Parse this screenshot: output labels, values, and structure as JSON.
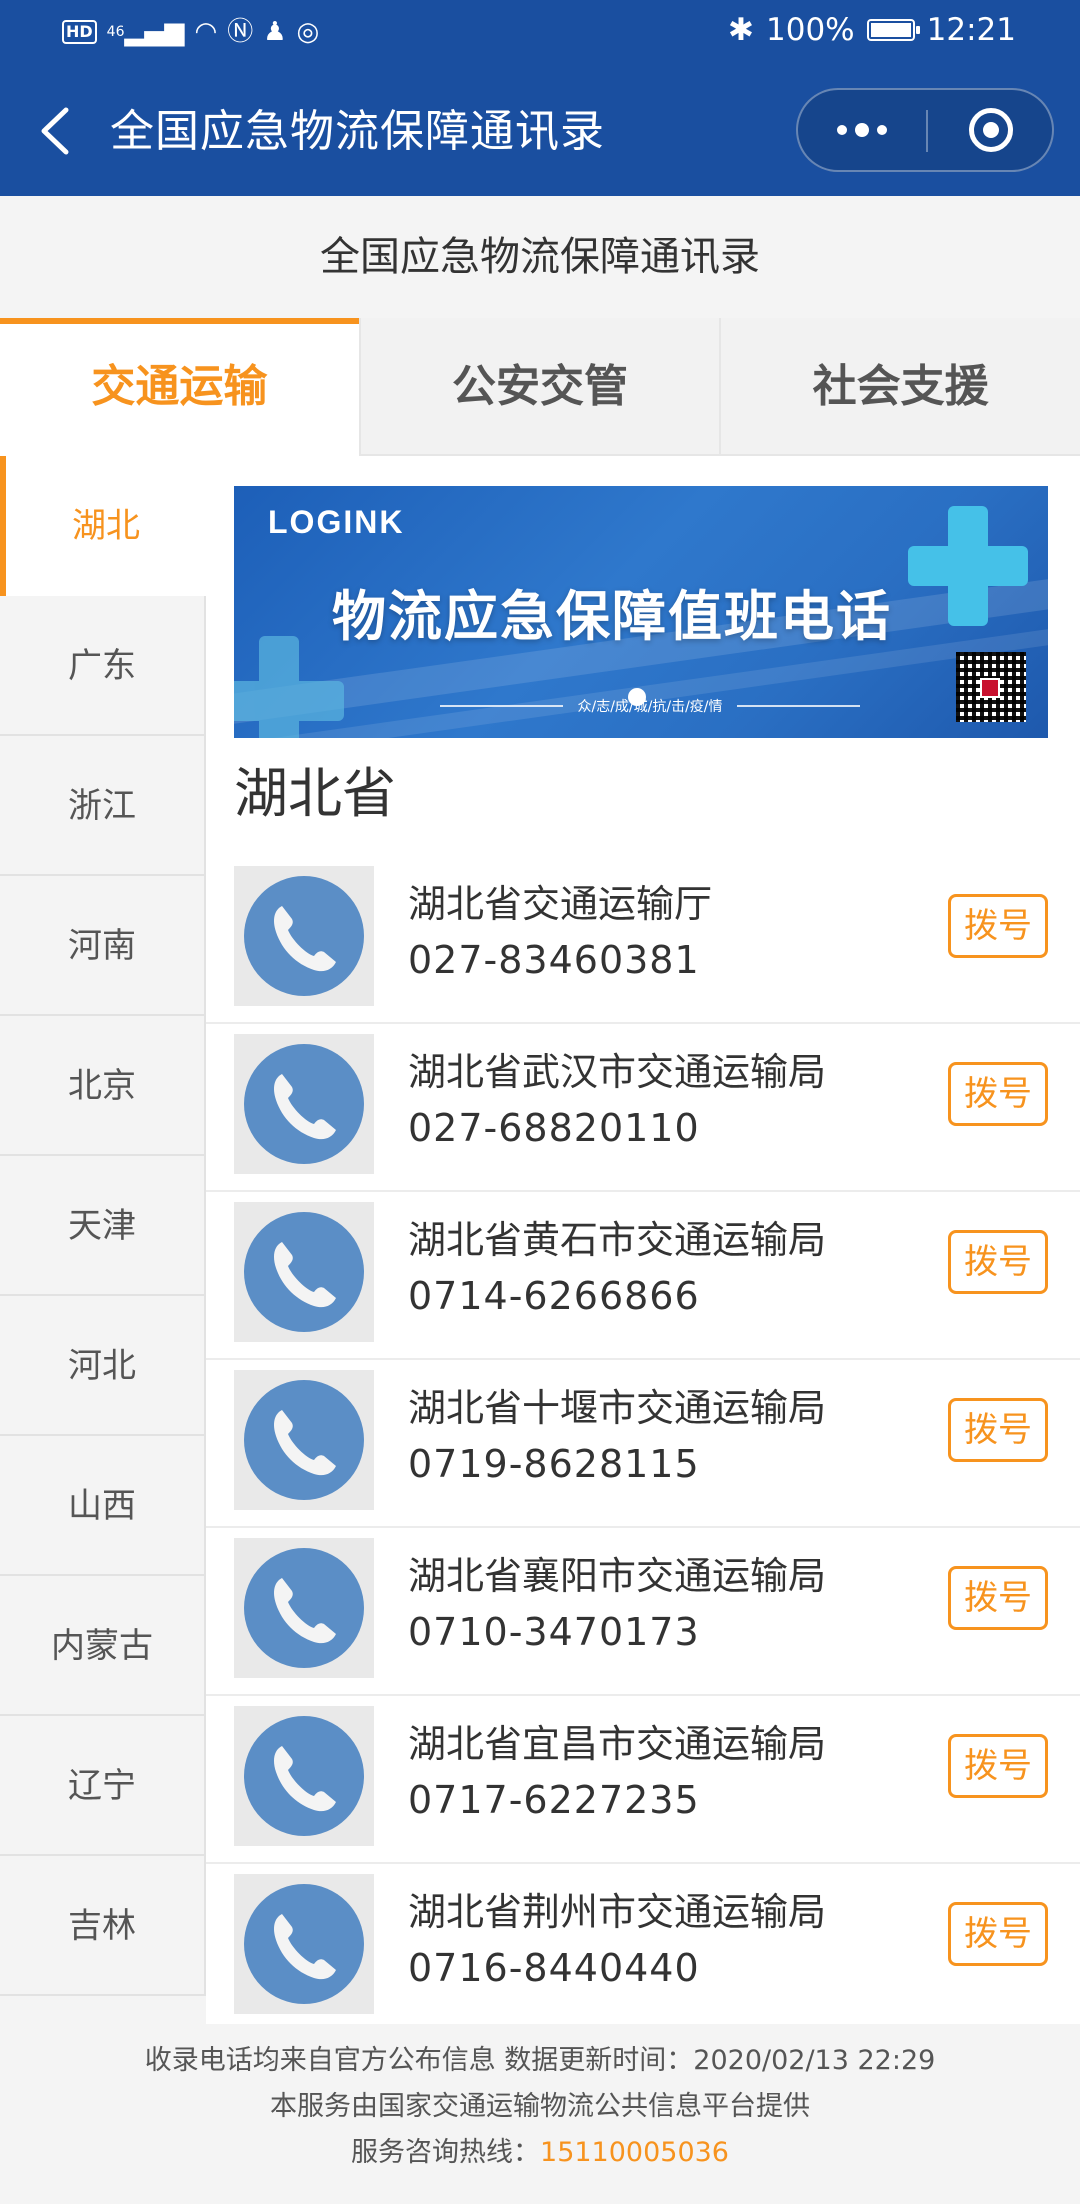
{
  "status_bar": {
    "left_icons": [
      "hd-badge",
      "4g-signal-icon",
      "wifi-icon",
      "nfc-icon",
      "qq-icon",
      "weibo-icon"
    ],
    "hd_label": "HD",
    "network_label": "46",
    "battery": "100%",
    "battery_level": 1.0,
    "time": "12:21"
  },
  "titlebar": {
    "title": "全国应急物流保障通讯录"
  },
  "page_header": {
    "title": "全国应急物流保障通讯录"
  },
  "tabs": [
    {
      "label": "交通运输",
      "active": true
    },
    {
      "label": "公安交管",
      "active": false
    },
    {
      "label": "社会支援",
      "active": false
    }
  ],
  "sidebar": {
    "items": [
      {
        "label": "湖北",
        "active": true
      },
      {
        "label": "广东",
        "active": false
      },
      {
        "label": "浙江",
        "active": false
      },
      {
        "label": "河南",
        "active": false
      },
      {
        "label": "北京",
        "active": false
      },
      {
        "label": "天津",
        "active": false
      },
      {
        "label": "河北",
        "active": false
      },
      {
        "label": "山西",
        "active": false
      },
      {
        "label": "内蒙古",
        "active": false
      },
      {
        "label": "辽宁",
        "active": false
      },
      {
        "label": "吉林",
        "active": false
      }
    ]
  },
  "banner": {
    "logo": "LOGINK",
    "headline": "物流应急保障值班电话",
    "slogan": "众/志/成/城/抗/击/疫/情"
  },
  "section": {
    "title": "湖北省"
  },
  "contacts": [
    {
      "name": "湖北省交通运输厅",
      "phone": "027-83460381",
      "dial_label": "拨号"
    },
    {
      "name": "湖北省武汉市交通运输局",
      "phone": "027-68820110",
      "dial_label": "拨号"
    },
    {
      "name": "湖北省黄石市交通运输局",
      "phone": "0714-6266866",
      "dial_label": "拨号"
    },
    {
      "name": "湖北省十堰市交通运输局",
      "phone": "0719-8628115",
      "dial_label": "拨号"
    },
    {
      "name": "湖北省襄阳市交通运输局",
      "phone": "0710-3470173",
      "dial_label": "拨号"
    },
    {
      "name": "湖北省宜昌市交通运输局",
      "phone": "0717-6227235",
      "dial_label": "拨号"
    },
    {
      "name": "湖北省荆州市交通运输局",
      "phone": "0716-8440440",
      "dial_label": "拨号"
    }
  ],
  "footer": {
    "line1": "收录电话均来自官方公布信息 数据更新时间：2020/02/13 22:29",
    "line2": "本服务由国家交通运输物流公共信息平台提供",
    "hotline_label": "服务咨询热线：",
    "hotline_number": "15110005036"
  },
  "colors": {
    "brand_blue": "#1a4fa0",
    "accent_orange": "#f7931e",
    "phone_icon_blue": "#5b8ec6"
  }
}
